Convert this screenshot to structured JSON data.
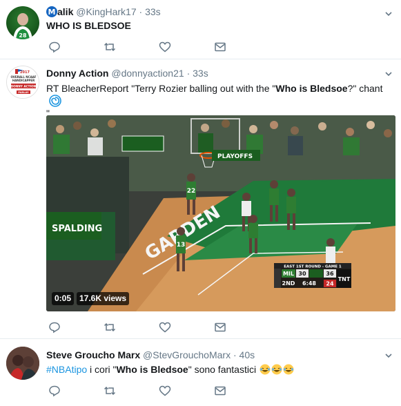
{
  "colors": {
    "text": "#14171a",
    "muted": "#657786",
    "link": "#1b95e0",
    "border": "#e6ecf0",
    "court_green": "#1f7a3a"
  },
  "tweets": [
    {
      "avatar_icon": "player-avatar",
      "name_prefix_icon": "bold-m-icon",
      "name": "alik",
      "handle": "@KingHark17",
      "separator": "·",
      "time": "33s",
      "text": "WHO IS BLEDSOE"
    },
    {
      "avatar_icon": "donny-action-logo",
      "name": "Donny Action",
      "handle": "@donnyaction21",
      "separator": "·",
      "time": "33s",
      "text_prefix": "RT BleacherReport \"Terry Rozier balling out with the \"",
      "text_bold": "Who is Bledsoe",
      "text_suffix": "?\" chant",
      "text_line2": "\"",
      "logo_text": {
        "year": "2017",
        "line1": "OVERALL NCAAF",
        "line2": "HANDICAPPER",
        "brand": "DONNY ACTION",
        "tag": "PARLAY"
      },
      "video": {
        "duration": "0:05",
        "views": "17.6K views",
        "scoreboard": {
          "round": "EAST 1ST ROUND - GAME 1",
          "team1": "MIL",
          "score1": "30",
          "score2": "36",
          "quarter": "2ND",
          "clock": "6:48",
          "shot_clock": "24",
          "network": "TNT"
        },
        "court_text": "GARDEN",
        "banner_text": "PLAYOFFS",
        "ad_text": "SPALDING",
        "jersey_numbers": [
          "13",
          "22"
        ]
      }
    },
    {
      "avatar_icon": "group-selfie-avatar",
      "name": "Steve Groucho Marx",
      "handle": "@StevGrouchoMarx",
      "separator": "·",
      "time": "40s",
      "hashtag": "#NBAtipo",
      "text_mid": " i cori \"",
      "text_bold": "Who is Bledsoe",
      "text_suffix": "\" sono fantastici",
      "emoji": "laughing-emoji"
    }
  ]
}
